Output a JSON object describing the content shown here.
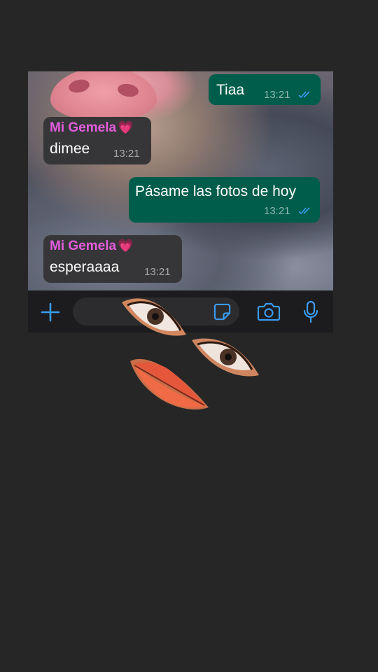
{
  "chat": {
    "messages": [
      {
        "direction": "outgoing",
        "text": "Tiaa",
        "time": "13:21",
        "status": "read"
      },
      {
        "direction": "incoming",
        "sender": "Mi Gemela",
        "sender_emoji": "💗",
        "text": "dimee",
        "time": "13:21"
      },
      {
        "direction": "outgoing",
        "text": "Pásame las fotos de hoy",
        "time": "13:21",
        "status": "read"
      },
      {
        "direction": "incoming",
        "sender": "Mi Gemela",
        "sender_emoji": "💗",
        "text": "esperaaaa",
        "time": "13:21"
      }
    ]
  },
  "input_bar": {
    "icons": [
      "plus-icon",
      "sticker-icon",
      "camera-icon",
      "microphone-icon"
    ]
  },
  "colors": {
    "accent": "#3a9bf5",
    "outgoing_bubble": "#005c4b",
    "incoming_bubble": "#363638",
    "sender_name": "#e35ddc",
    "page_background": "#262626"
  },
  "decorations": [
    "eye-cutout",
    "eye-cutout",
    "lips-cutout"
  ]
}
